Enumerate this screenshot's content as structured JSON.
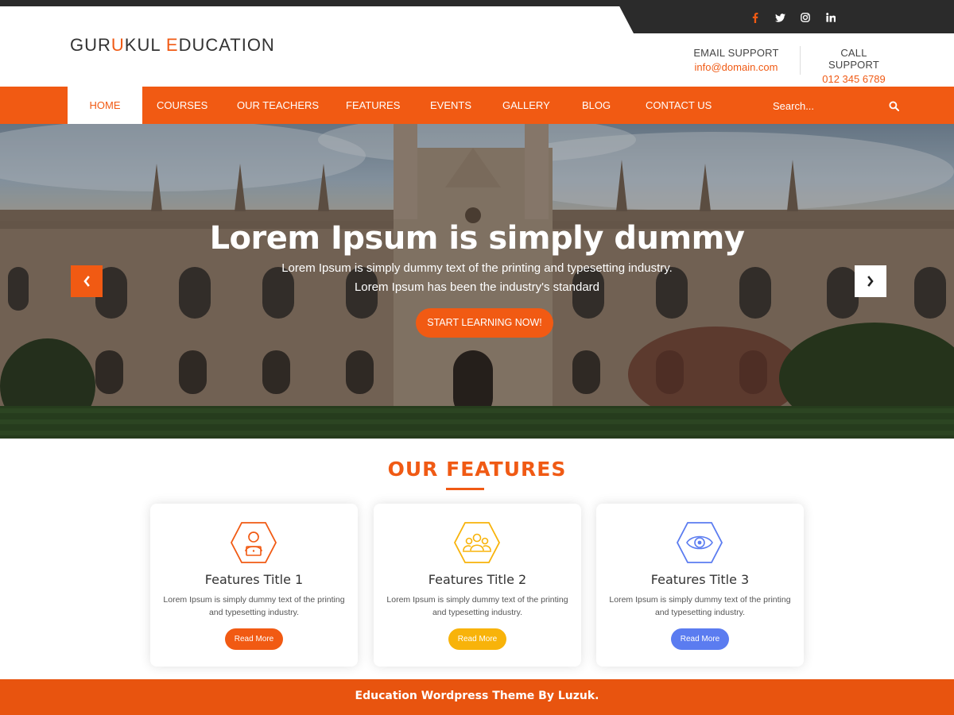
{
  "colors": {
    "accent": "#f15a13",
    "dark": "#2b2b2b",
    "yellow": "#f8b30a",
    "blue": "#5b7cf0"
  },
  "social": [
    {
      "icon": "facebook-icon",
      "color": "#f15a13"
    },
    {
      "icon": "twitter-icon",
      "color": "#ffffff"
    },
    {
      "icon": "instagram-icon",
      "color": "#ffffff"
    },
    {
      "icon": "linkedin-icon",
      "color": "#ffffff"
    }
  ],
  "header": {
    "logo": {
      "part1": "GUR",
      "accent1": "U",
      "part2": "KUL ",
      "accent2": "E",
      "part3": "DUCATION"
    },
    "email_support": {
      "label": "EMAIL SUPPORT",
      "value": "info@domain.com"
    },
    "call_support": {
      "label": "CALL SUPPORT",
      "value": "012 345 6789"
    }
  },
  "nav": {
    "items": [
      "HOME",
      "COURSES",
      "OUR TEACHERS",
      "FEATURES",
      "EVENTS",
      "GALLERY",
      "BLOG",
      "CONTACT US"
    ],
    "active": "HOME",
    "search_placeholder": "Search...",
    "search_icon": "search-icon"
  },
  "hero": {
    "title": "Lorem Ipsum is simply dummy",
    "subtitle_line1": "Lorem Ipsum is simply dummy text of the printing and typesetting industry.",
    "subtitle_line2": "Lorem Ipsum has been the industry's standard",
    "cta": "START LEARNING NOW!",
    "prev_icon": "chevron-left-icon",
    "next_icon": "chevron-right-icon"
  },
  "features": {
    "heading": "OUR FEATURES",
    "cards": [
      {
        "title": "Features Title 1",
        "desc_line1": "Lorem Ipsum is simply dummy text of the printing",
        "desc_line2": "and typesetting industry.",
        "button": "Read More",
        "icon": "student-laptop-icon",
        "color": "#f15a13"
      },
      {
        "title": "Features Title 2",
        "desc_line1": "Lorem Ipsum is simply dummy text of the printing",
        "desc_line2": "and typesetting industry.",
        "button": "Read More",
        "icon": "group-users-icon",
        "color": "#f8b30a"
      },
      {
        "title": "Features Title 3",
        "desc_line1": "Lorem Ipsum is simply dummy text of the printing",
        "desc_line2": "and typesetting industry.",
        "button": "Read More",
        "icon": "eye-icon",
        "color": "#5b7cf0"
      }
    ]
  },
  "footer": {
    "text": "Education Wordpress Theme By Luzuk."
  }
}
